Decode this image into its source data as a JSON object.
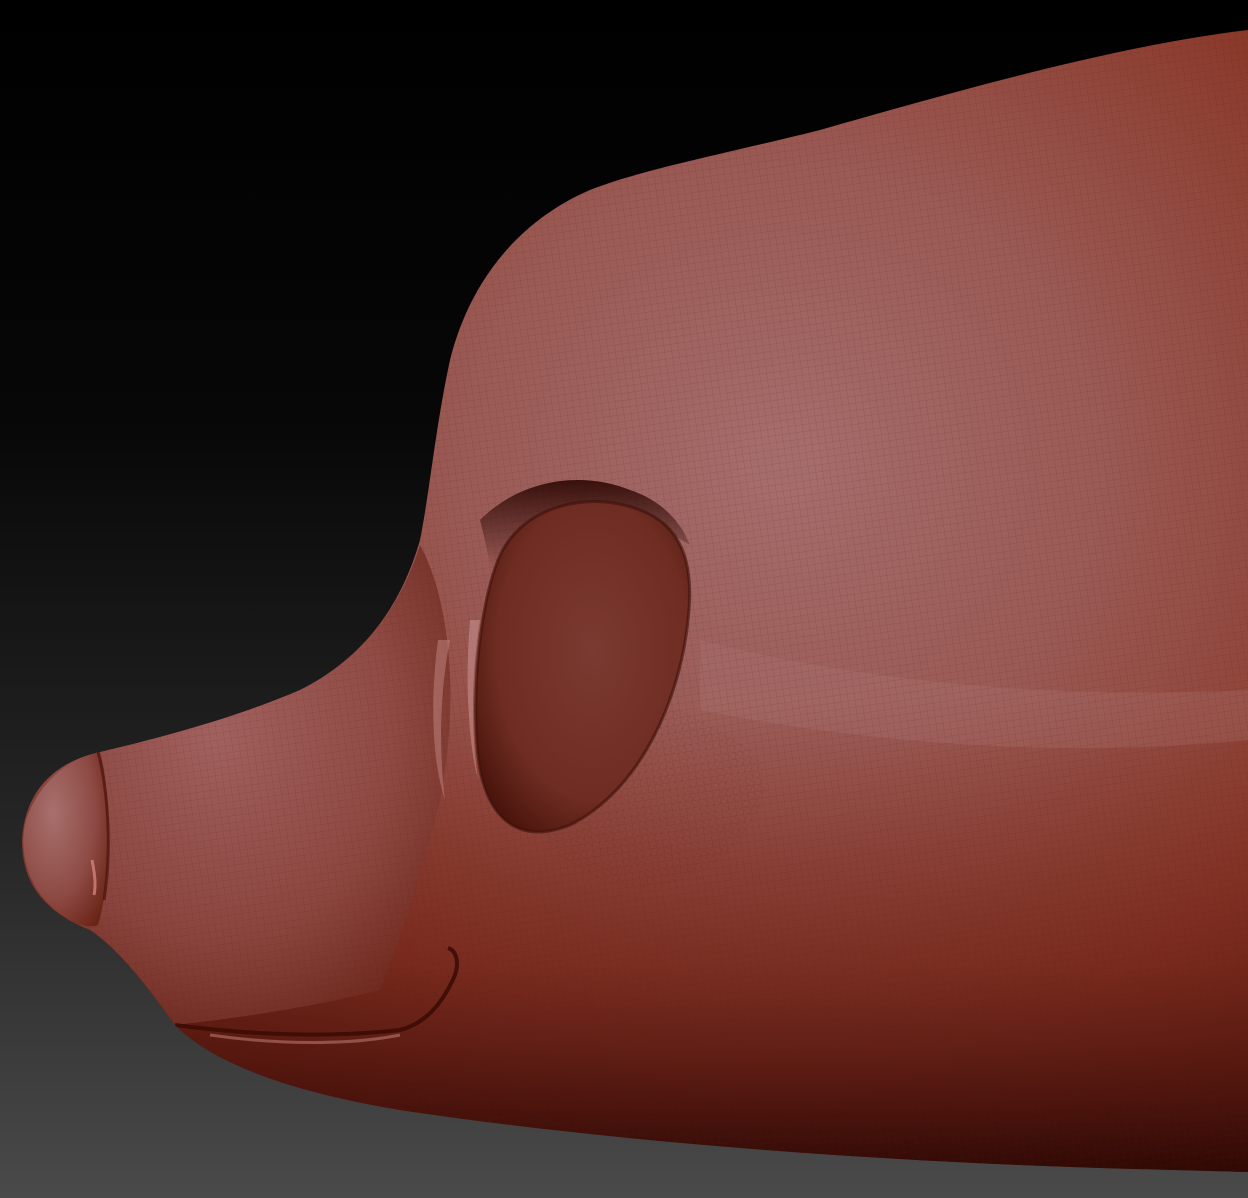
{
  "viewport": {
    "background_top": "#000000",
    "background_bottom": "#4a4a4a"
  },
  "model": {
    "subject": "sculpted-animal-head-side-view",
    "material_base": "#8e3b2c",
    "material_highlight": "#a9706f",
    "material_shadow": "#3a0d07",
    "wireframe_visible": true,
    "polyframe_color": "#6e2a1f"
  }
}
